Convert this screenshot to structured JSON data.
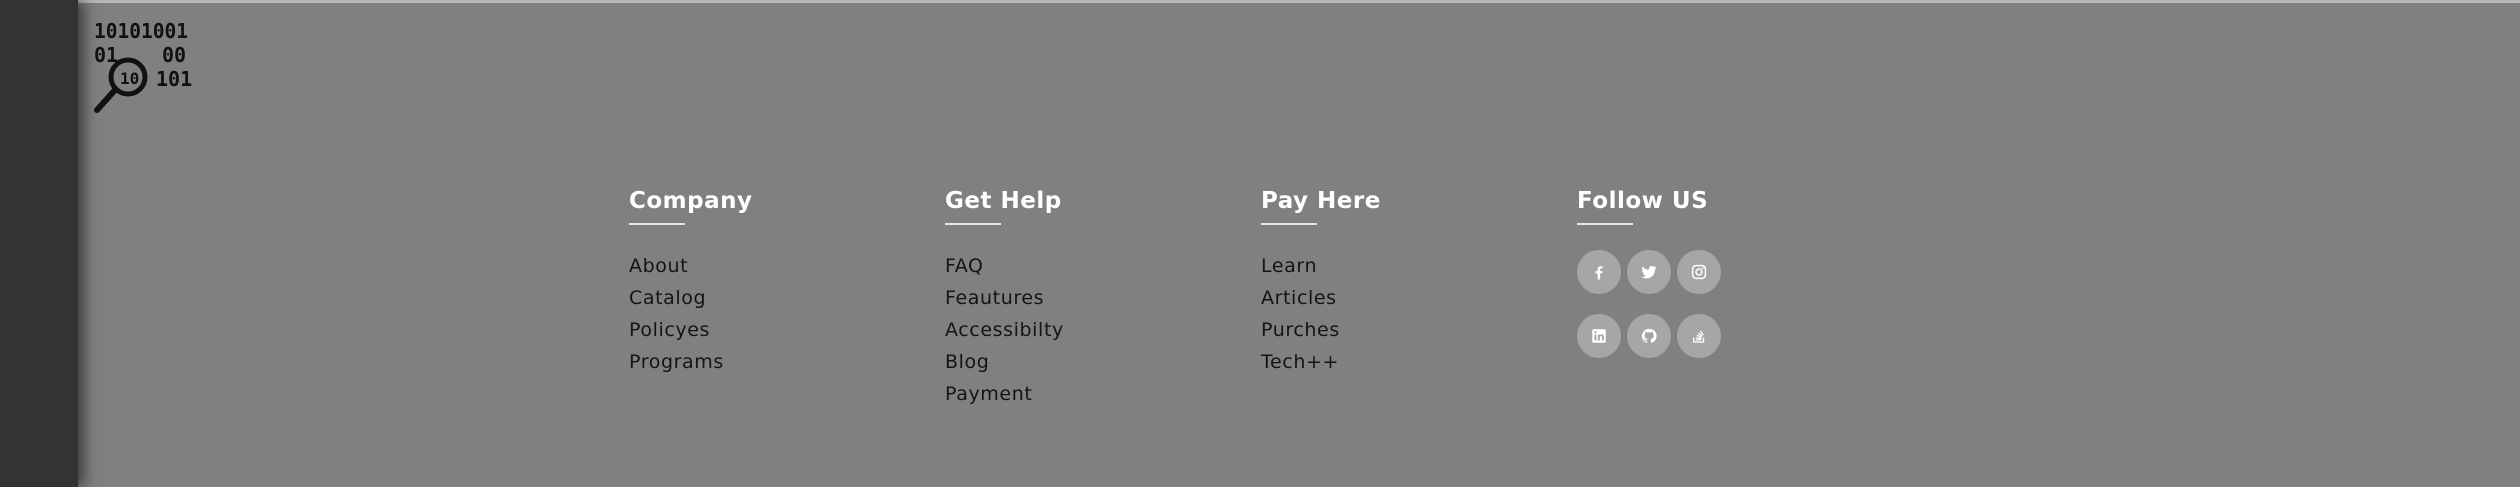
{
  "footer": {
    "columns": [
      {
        "title": "Company",
        "links": [
          "About",
          "Catalog",
          "Policyes",
          "Programs"
        ]
      },
      {
        "title": "Get Help",
        "links": [
          "FAQ",
          "Feautures",
          "Accessibilty",
          "Blog",
          "Payment"
        ]
      },
      {
        "title": "Pay Here",
        "links": [
          "Learn",
          "Articles",
          "Purches",
          "Tech++"
        ]
      }
    ],
    "follow": {
      "title": "Follow US",
      "icons": [
        "facebook-icon",
        "twitter-icon",
        "instagram-icon",
        "linkedin-icon",
        "github-icon",
        "stack-overflow-icon"
      ]
    }
  },
  "logo": {
    "icon": "binary-magnifier-logo",
    "binary_rows": [
      "10101001",
      "01",
      "00",
      "10",
      "101"
    ]
  },
  "colors": {
    "background": "#808080",
    "sidebar": "#333333",
    "heading": "#ffffff",
    "link": "#141414",
    "social_bg": "#a6a6a6"
  }
}
